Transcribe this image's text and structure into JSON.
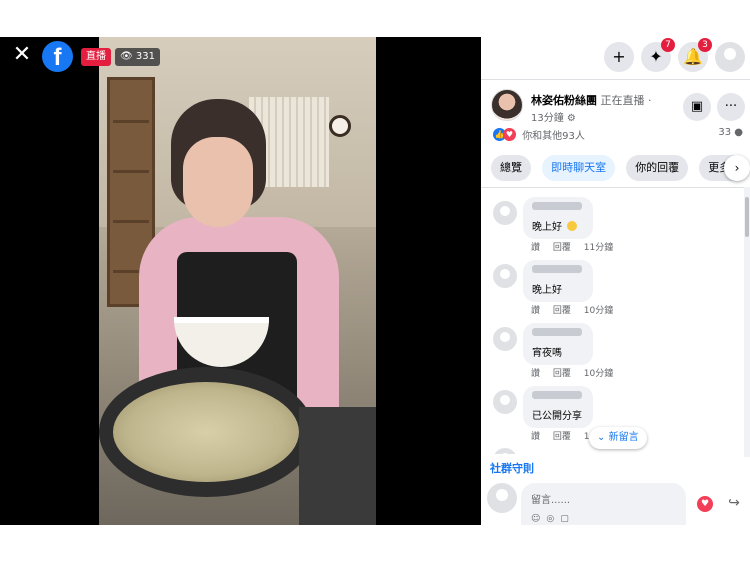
{
  "video": {
    "live_label": "直播",
    "viewer_count": "331"
  },
  "topbar": {
    "messenger_badge": "7",
    "notifications_badge": "3"
  },
  "post": {
    "page_name": "林姿佑粉絲團",
    "live_status": "正在直播",
    "time": "13分鐘",
    "reactions_text": "你和其他93人",
    "comment_count": "33"
  },
  "tabs": [
    "總覽",
    "即時聊天室",
    "你的回覆",
    "更多影"
  ],
  "comments": [
    {
      "text": "晚上好",
      "like": "讚",
      "reply": "回覆",
      "time": "11分鐘",
      "emoji": true
    },
    {
      "text": "晚上好",
      "like": "讚",
      "reply": "回覆",
      "time": "10分鐘",
      "emoji": false
    },
    {
      "text": "宵夜嗎",
      "like": "讚",
      "reply": "回覆",
      "time": "10分鐘",
      "emoji": false
    },
    {
      "text": "已公開分享",
      "like": "讚",
      "reply": "回覆",
      "time": "10分鐘",
      "emoji": false
    }
  ],
  "new_comments_label": "新留言",
  "community_link": "社群守則",
  "compose": {
    "placeholder": "留言......"
  },
  "colors": {
    "accent": "#1877f2",
    "live_red": "#e41e3f",
    "love": "#f33e58"
  },
  "icons": [
    "close-icon",
    "facebook-logo",
    "eye-icon",
    "plus-icon",
    "messenger-icon",
    "bell-icon",
    "profile-icon",
    "add-to-story-icon",
    "more-icon",
    "chevron-right-icon",
    "like-icon",
    "love-icon",
    "comment-icon",
    "heart-icon",
    "share-icon"
  ]
}
